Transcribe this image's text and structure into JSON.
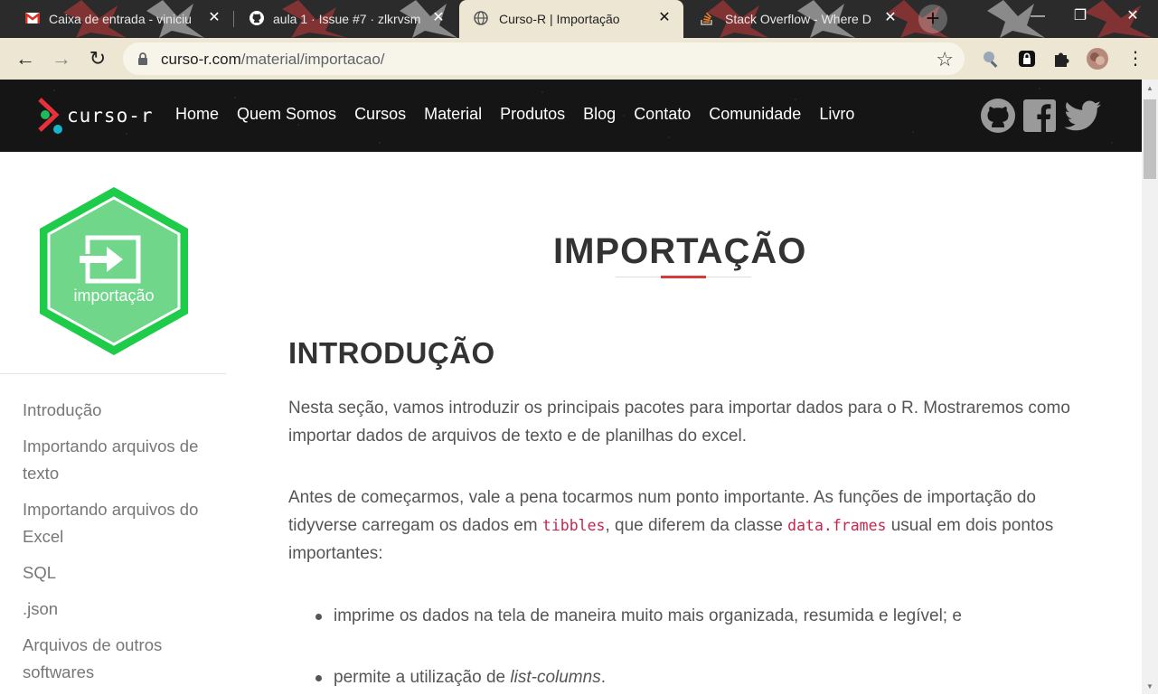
{
  "browser": {
    "tabs": [
      {
        "title": "Caixa de entrada - viniciu",
        "icon": "gmail-icon"
      },
      {
        "title": "aula 1 · Issue #7 · zlkrvsm",
        "icon": "github-icon"
      },
      {
        "title": "Curso-R | Importação",
        "icon": "globe-icon",
        "active": true
      },
      {
        "title": "Stack Overflow - Where D",
        "icon": "stackoverflow-icon"
      }
    ],
    "url_host": "curso-r.com",
    "url_path": "/material/importacao/"
  },
  "site": {
    "logo_text": "curso-r",
    "nav": [
      "Home",
      "Quem Somos",
      "Cursos",
      "Material",
      "Produtos",
      "Blog",
      "Contato",
      "Comunidade",
      "Livro"
    ],
    "social": [
      "github-icon",
      "facebook-icon",
      "twitter-icon"
    ]
  },
  "sidebar": {
    "hex_label": "importação",
    "toc": [
      "Introdução",
      "Importando arquivos de texto",
      "Importando arquivos do Excel",
      "SQL",
      ".json",
      "Arquivos de outros softwares"
    ]
  },
  "content": {
    "page_title": "IMPORTAÇÃO",
    "section_title": "INTRODUÇÃO",
    "para1": "Nesta seção, vamos introduzir os principais pacotes para importar dados para o R. Mostraremos como importar dados de arquivos de texto e de planilhas do excel.",
    "para2_a": "Antes de começarmos, vale a pena tocarmos num ponto importante. As funções de importação do tidyverse carregam os dados em ",
    "para2_code1": "tibbles",
    "para2_b": ", que diferem da classe ",
    "para2_code2": "data.frames",
    "para2_c": " usual em dois pontos importantes:",
    "bullet1": "imprime os dados na tela de maneira muito mais organizada, resumida e legível; e",
    "bullet2_a": "permite a utilização de ",
    "bullet2_em": "list-columns",
    "bullet2_b": "."
  }
}
